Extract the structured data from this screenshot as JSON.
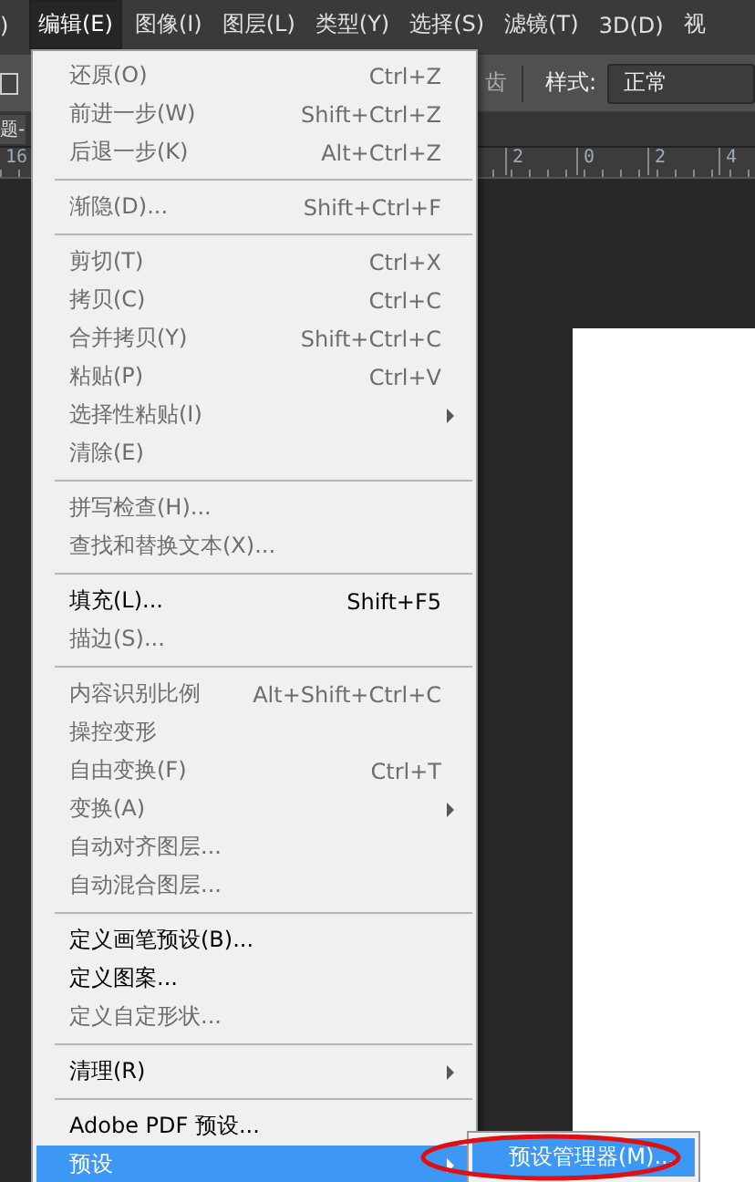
{
  "menubar": [
    {
      "label": ")",
      "selected": false
    },
    {
      "label": "编辑(E)",
      "selected": true
    },
    {
      "label": "图像(I)",
      "selected": false
    },
    {
      "label": "图层(L)",
      "selected": false
    },
    {
      "label": "类型(Y)",
      "selected": false
    },
    {
      "label": "选择(S)",
      "selected": false
    },
    {
      "label": "滤镜(T)",
      "selected": false
    },
    {
      "label": "3D(D)",
      "selected": false
    },
    {
      "label": "视",
      "selected": false
    }
  ],
  "options_bar": {
    "antialias_label": "齿",
    "style_label": "样式:",
    "style_value": "正常"
  },
  "document_tab": {
    "label": "题-"
  },
  "ruler": {
    "labels": [
      "16",
      "2",
      "0",
      "2",
      "4"
    ]
  },
  "menu": {
    "groups": [
      [
        {
          "label": "还原(O)",
          "shortcut": "Ctrl+Z",
          "disabled": true,
          "submenu": false,
          "selected": false
        },
        {
          "label": "前进一步(W)",
          "shortcut": "Shift+Ctrl+Z",
          "disabled": true,
          "submenu": false,
          "selected": false
        },
        {
          "label": "后退一步(K)",
          "shortcut": "Alt+Ctrl+Z",
          "disabled": true,
          "submenu": false,
          "selected": false
        }
      ],
      [
        {
          "label": "渐隐(D)...",
          "shortcut": "Shift+Ctrl+F",
          "disabled": true,
          "submenu": false,
          "selected": false
        }
      ],
      [
        {
          "label": "剪切(T)",
          "shortcut": "Ctrl+X",
          "disabled": true,
          "submenu": false,
          "selected": false
        },
        {
          "label": "拷贝(C)",
          "shortcut": "Ctrl+C",
          "disabled": true,
          "submenu": false,
          "selected": false
        },
        {
          "label": "合并拷贝(Y)",
          "shortcut": "Shift+Ctrl+C",
          "disabled": true,
          "submenu": false,
          "selected": false
        },
        {
          "label": "粘贴(P)",
          "shortcut": "Ctrl+V",
          "disabled": true,
          "submenu": false,
          "selected": false
        },
        {
          "label": "选择性粘贴(I)",
          "disabled": true,
          "submenu": true,
          "selected": false
        },
        {
          "label": "清除(E)",
          "disabled": true,
          "submenu": false,
          "selected": false
        }
      ],
      [
        {
          "label": "拼写检查(H)...",
          "disabled": true,
          "submenu": false,
          "selected": false
        },
        {
          "label": "查找和替换文本(X)...",
          "disabled": true,
          "submenu": false,
          "selected": false
        }
      ],
      [
        {
          "label": "填充(L)...",
          "shortcut": "Shift+F5",
          "disabled": false,
          "submenu": false,
          "selected": false
        },
        {
          "label": "描边(S)...",
          "disabled": true,
          "submenu": false,
          "selected": false
        }
      ],
      [
        {
          "label": "内容识别比例",
          "shortcut": "Alt+Shift+Ctrl+C",
          "disabled": true,
          "submenu": false,
          "selected": false
        },
        {
          "label": "操控变形",
          "disabled": true,
          "submenu": false,
          "selected": false
        },
        {
          "label": "自由变换(F)",
          "shortcut": "Ctrl+T",
          "disabled": true,
          "submenu": false,
          "selected": false
        },
        {
          "label": "变换(A)",
          "disabled": true,
          "submenu": true,
          "selected": false
        },
        {
          "label": "自动对齐图层...",
          "disabled": true,
          "submenu": false,
          "selected": false
        },
        {
          "label": "自动混合图层...",
          "disabled": true,
          "submenu": false,
          "selected": false
        }
      ],
      [
        {
          "label": "定义画笔预设(B)...",
          "disabled": false,
          "submenu": false,
          "selected": false
        },
        {
          "label": "定义图案...",
          "disabled": false,
          "submenu": false,
          "selected": false
        },
        {
          "label": "定义自定形状...",
          "disabled": true,
          "submenu": false,
          "selected": false
        }
      ],
      [
        {
          "label": "清理(R)",
          "disabled": false,
          "submenu": true,
          "selected": false
        }
      ],
      [
        {
          "label": "Adobe PDF 预设...",
          "disabled": false,
          "submenu": false,
          "selected": false
        },
        {
          "label": "预设",
          "disabled": false,
          "submenu": true,
          "selected": true
        }
      ]
    ]
  },
  "submenu": {
    "items": [
      {
        "label": "预设管理器(M)...",
        "selected": true,
        "circled": true
      }
    ]
  }
}
